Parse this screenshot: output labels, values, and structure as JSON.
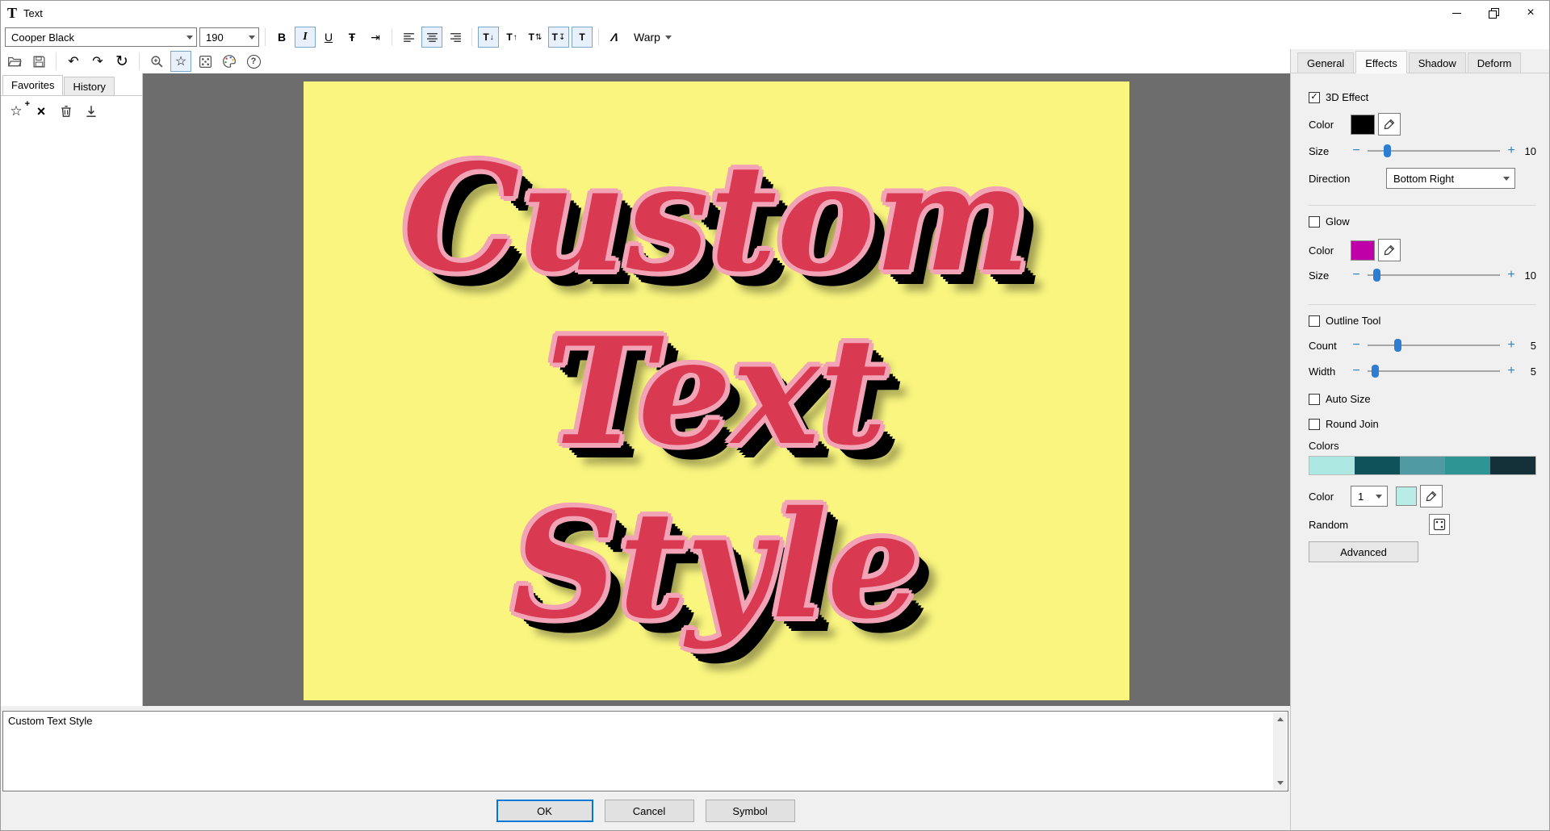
{
  "colors": {
    "accent": "#0078d7",
    "slider_thumb": "#2d7dd2",
    "plus_minus": "#2e7fc2",
    "canvas_surround": "#6d6d6d"
  },
  "window": {
    "icon_glyph": "T",
    "title": "Text",
    "close_glyph": "×"
  },
  "font_toolbar": {
    "font_family": "Cooper Black",
    "font_size": "190",
    "warp_label": "Warp"
  },
  "icons": {
    "bold": "B",
    "italic": "I",
    "underline": "U",
    "strikethrough": "Ŧ",
    "tab_stop": "⇥",
    "undo": "↶",
    "redo": "↷",
    "refresh": "↻",
    "star": "☆",
    "plus": "+",
    "minus": "−",
    "delete_x": "×",
    "help": "?",
    "warp_style": "Λ",
    "check": "✓"
  },
  "vtext_icons": [
    {
      "t": "T",
      "a": "↓"
    },
    {
      "t": "T",
      "a": "↑"
    },
    {
      "t": "T",
      "a": "⇅"
    },
    {
      "t": "T",
      "a": "↧"
    },
    {
      "t": "T",
      "a": ""
    }
  ],
  "left_panel": {
    "tabs": [
      {
        "label": "Favorites"
      },
      {
        "label": "History"
      }
    ]
  },
  "canvas": {
    "lines": [
      "Custom",
      "Text",
      "Style"
    ],
    "background_color": "#f9f57f",
    "fill_color": "#d93a52",
    "outline_color": "#f2a4b6",
    "extrude_color": "#000000"
  },
  "right_panel": {
    "tabs": [
      {
        "label": "General"
      },
      {
        "label": "Effects"
      },
      {
        "label": "Shadow"
      },
      {
        "label": "Deform"
      }
    ],
    "three_d": {
      "label": "3D Effect",
      "check_glyph": "✓",
      "color_label": "Color",
      "color": "#000000",
      "size_label": "Size",
      "size": "10",
      "direction_label": "Direction",
      "direction": "Bottom Right"
    },
    "glow": {
      "label": "Glow",
      "color_label": "Color",
      "color": "#bf00a8",
      "size_label": "Size",
      "size": "10"
    },
    "outline_tool": {
      "label": "Outline Tool",
      "count_label": "Count",
      "count": "5",
      "width_label": "Width",
      "width": "5"
    },
    "auto_size_label": "Auto Size",
    "round_join_label": "Round Join",
    "colors_label": "Colors",
    "palette": [
      "#ade7e1",
      "#10525a",
      "#4f9aa3",
      "#2e9494",
      "#14313a"
    ],
    "color_row": {
      "label": "Color",
      "index": "1",
      "swatch": "#b8ece6"
    },
    "random_label": "Random",
    "advanced_label": "Advanced"
  },
  "text_input": {
    "value": "Custom Text Style"
  },
  "footer": {
    "ok_label": "OK",
    "cancel_label": "Cancel",
    "symbol_label": "Symbol"
  }
}
